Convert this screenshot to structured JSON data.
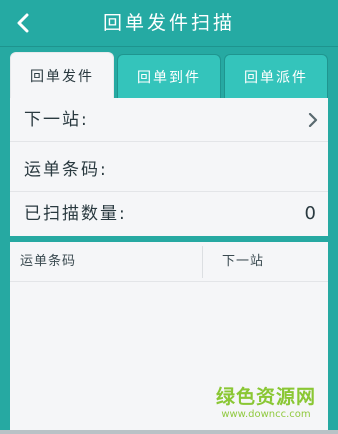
{
  "header": {
    "title": "回单发件扫描",
    "back_icon": "back-arrow-icon"
  },
  "tabs": [
    {
      "label": "回单发件",
      "active": true
    },
    {
      "label": "回单到件",
      "active": false
    },
    {
      "label": "回单派件",
      "active": false
    }
  ],
  "form": {
    "next_station_label": "下一站:",
    "waybill_label": "运单条码:",
    "scanned_count_label": "已扫描数量:",
    "scanned_count_value": "0"
  },
  "list": {
    "columns": [
      "运单条码",
      "下一站"
    ]
  },
  "watermark": {
    "text": "绿色资源网",
    "url": "www.downcc.com"
  },
  "colors": {
    "accent": "#26a9a2",
    "panel": "#f5f6f8",
    "watermark": "#7fc21f"
  }
}
